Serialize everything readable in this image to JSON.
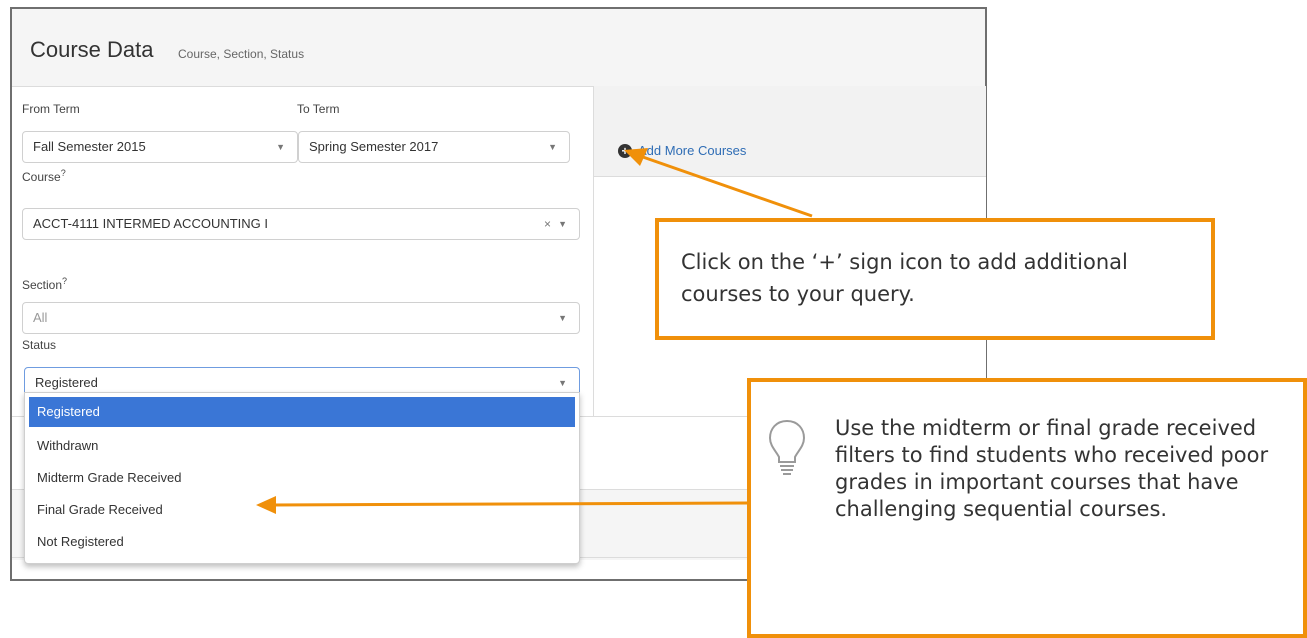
{
  "panel": {
    "title": "Course Data",
    "subtitle": "Course, Section, Status"
  },
  "filters": {
    "from_term": {
      "label": "From Term",
      "value": "Fall Semester 2015"
    },
    "to_term": {
      "label": "To Term",
      "value": "Spring Semester 2017"
    },
    "course": {
      "label": "Course",
      "help": "?",
      "value": "ACCT-4111 INTERMED ACCOUNTING I"
    },
    "section": {
      "label": "Section",
      "help": "?",
      "value": "All"
    },
    "status": {
      "label": "Status",
      "value": "Registered",
      "options": [
        "Registered",
        "Withdrawn",
        "Midterm Grade Received",
        "Final Grade Received",
        "Not Registered"
      ]
    }
  },
  "add_more": {
    "label": "Add More Courses",
    "icon": "plus-circle-icon"
  },
  "callouts": {
    "add_courses": "Click on the ‘+’ sign icon to add additional courses to your query.",
    "grade_tip": "Use the midterm or final grade received filters to find students who received poor grades in important courses that have challenging sequential courses."
  },
  "colors": {
    "accent_orange": "#f0900a",
    "selected_blue": "#3a76d6",
    "link_blue": "#2f6db5"
  }
}
